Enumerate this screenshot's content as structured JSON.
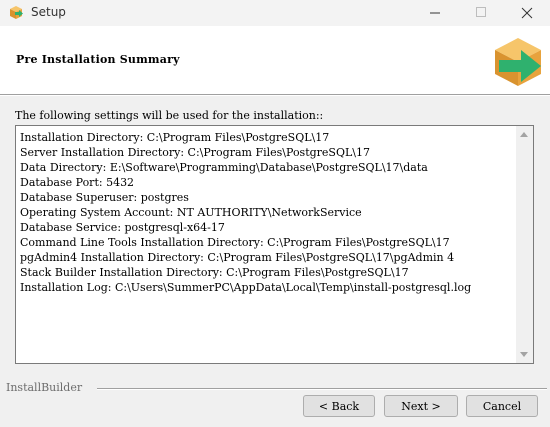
{
  "window": {
    "title": "Setup"
  },
  "header": {
    "title": "Pre Installation Summary"
  },
  "intro": "The following settings will be used for the installation::",
  "summary_lines": [
    "Installation Directory: C:\\Program Files\\PostgreSQL\\17",
    "Server Installation Directory: C:\\Program Files\\PostgreSQL\\17",
    "Data Directory: E:\\Software\\Programming\\Database\\PostgreSQL\\17\\data",
    "Database Port: 5432",
    "Database Superuser: postgres",
    "Operating System Account: NT AUTHORITY\\NetworkService",
    "Database Service: postgresql-x64-17",
    "Command Line Tools Installation Directory: C:\\Program Files\\PostgreSQL\\17",
    "pgAdmin4 Installation Directory: C:\\Program Files\\PostgreSQL\\17\\pgAdmin 4",
    "Stack Builder Installation Directory: C:\\Program Files\\PostgreSQL\\17",
    "Installation Log: C:\\Users\\SummerPC\\AppData\\Local\\Temp\\install-postgresql.log"
  ],
  "footer": {
    "brand": "InstallBuilder"
  },
  "buttons": {
    "back": "< Back",
    "next": "Next >",
    "cancel": "Cancel"
  },
  "icons": {
    "app": "installer-box-icon",
    "logo": "installer-box-arrow-icon",
    "minimize": "minimize-icon",
    "maximize": "maximize-icon",
    "close": "close-icon"
  },
  "colors": {
    "box_orange": "#e8a33d",
    "arrow_green": "#2fb16e"
  }
}
